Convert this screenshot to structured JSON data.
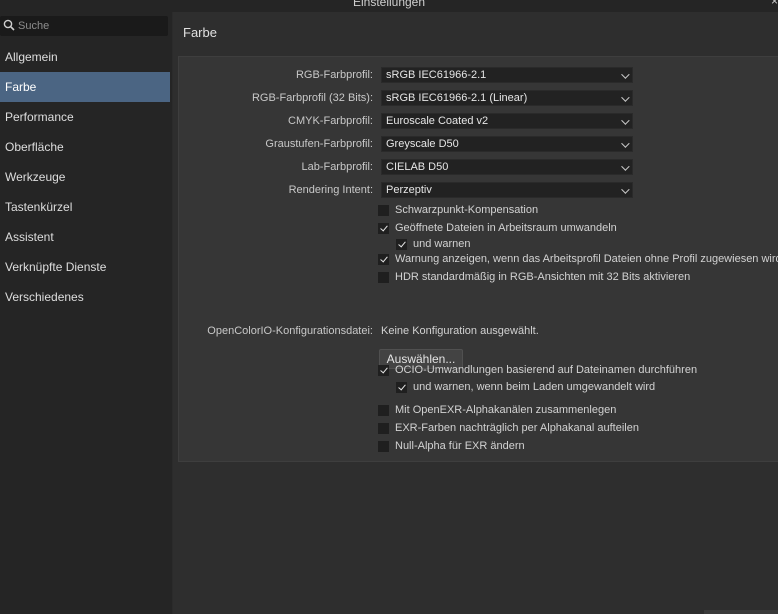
{
  "window": {
    "title": "Einstellungen",
    "close_glyph": "×"
  },
  "sidebar": {
    "search_placeholder": "Suche",
    "items": [
      {
        "label": "Allgemein",
        "active": false
      },
      {
        "label": "Farbe",
        "active": true
      },
      {
        "label": "Performance",
        "active": false
      },
      {
        "label": "Oberfläche",
        "active": false
      },
      {
        "label": "Werkzeuge",
        "active": false
      },
      {
        "label": "Tastenkürzel",
        "active": false
      },
      {
        "label": "Assistent",
        "active": false
      },
      {
        "label": "Verknüpfte Dienste",
        "active": false
      },
      {
        "label": "Verschiedenes",
        "active": false
      }
    ]
  },
  "main": {
    "title": "Farbe",
    "profiles": [
      {
        "label": "RGB-Farbprofil:",
        "value": "sRGB IEC61966-2.1"
      },
      {
        "label": "RGB-Farbprofil (32 Bits):",
        "value": "sRGB IEC61966-2.1 (Linear)"
      },
      {
        "label": "CMYK-Farbprofil:",
        "value": "Euroscale Coated v2"
      },
      {
        "label": "Graustufen-Farbprofil:",
        "value": "Greyscale D50"
      },
      {
        "label": "Lab-Farbprofil:",
        "value": "CIELAB D50"
      },
      {
        "label": "Rendering Intent:",
        "value": "Perzeptiv"
      }
    ],
    "checkboxes_color": [
      {
        "label": "Schwarzpunkt-Kompensation",
        "checked": false,
        "indent": false
      },
      {
        "label": "Geöffnete Dateien in Arbeitsraum umwandeln",
        "checked": true,
        "indent": false
      },
      {
        "label": "und warnen",
        "checked": true,
        "indent": true
      },
      {
        "label": "Warnung anzeigen, wenn das Arbeitsprofil Dateien ohne Profil zugewiesen wird",
        "checked": true,
        "indent": false
      },
      {
        "label": "HDR standardmäßig in RGB-Ansichten mit 32 Bits aktivieren",
        "checked": false,
        "indent": false
      }
    ],
    "ocio": {
      "label": "OpenColorIO-Konfigurationsdatei:",
      "value": "Keine Konfiguration ausgewählt.",
      "button_label": "Auswählen..."
    },
    "checkboxes_ocio": [
      {
        "label": "OCIO-Umwandlungen basierend auf Dateinamen durchführen",
        "checked": true,
        "indent": false
      },
      {
        "label": "und warnen, wenn beim Laden umgewandelt wird",
        "checked": true,
        "indent": true
      }
    ],
    "checkboxes_exr": [
      {
        "label": "Mit OpenEXR-Alphakanälen zusammenlegen",
        "checked": false,
        "indent": false
      },
      {
        "label": "EXR-Farben nachträglich per Alphakanal aufteilen",
        "checked": false,
        "indent": false
      },
      {
        "label": "Null-Alpha für EXR ändern",
        "checked": false,
        "indent": false
      }
    ]
  },
  "colors": {
    "accent": "#4b6583",
    "background": "#2e2e2e",
    "panel": "#363636",
    "sidebar": "#252525"
  }
}
